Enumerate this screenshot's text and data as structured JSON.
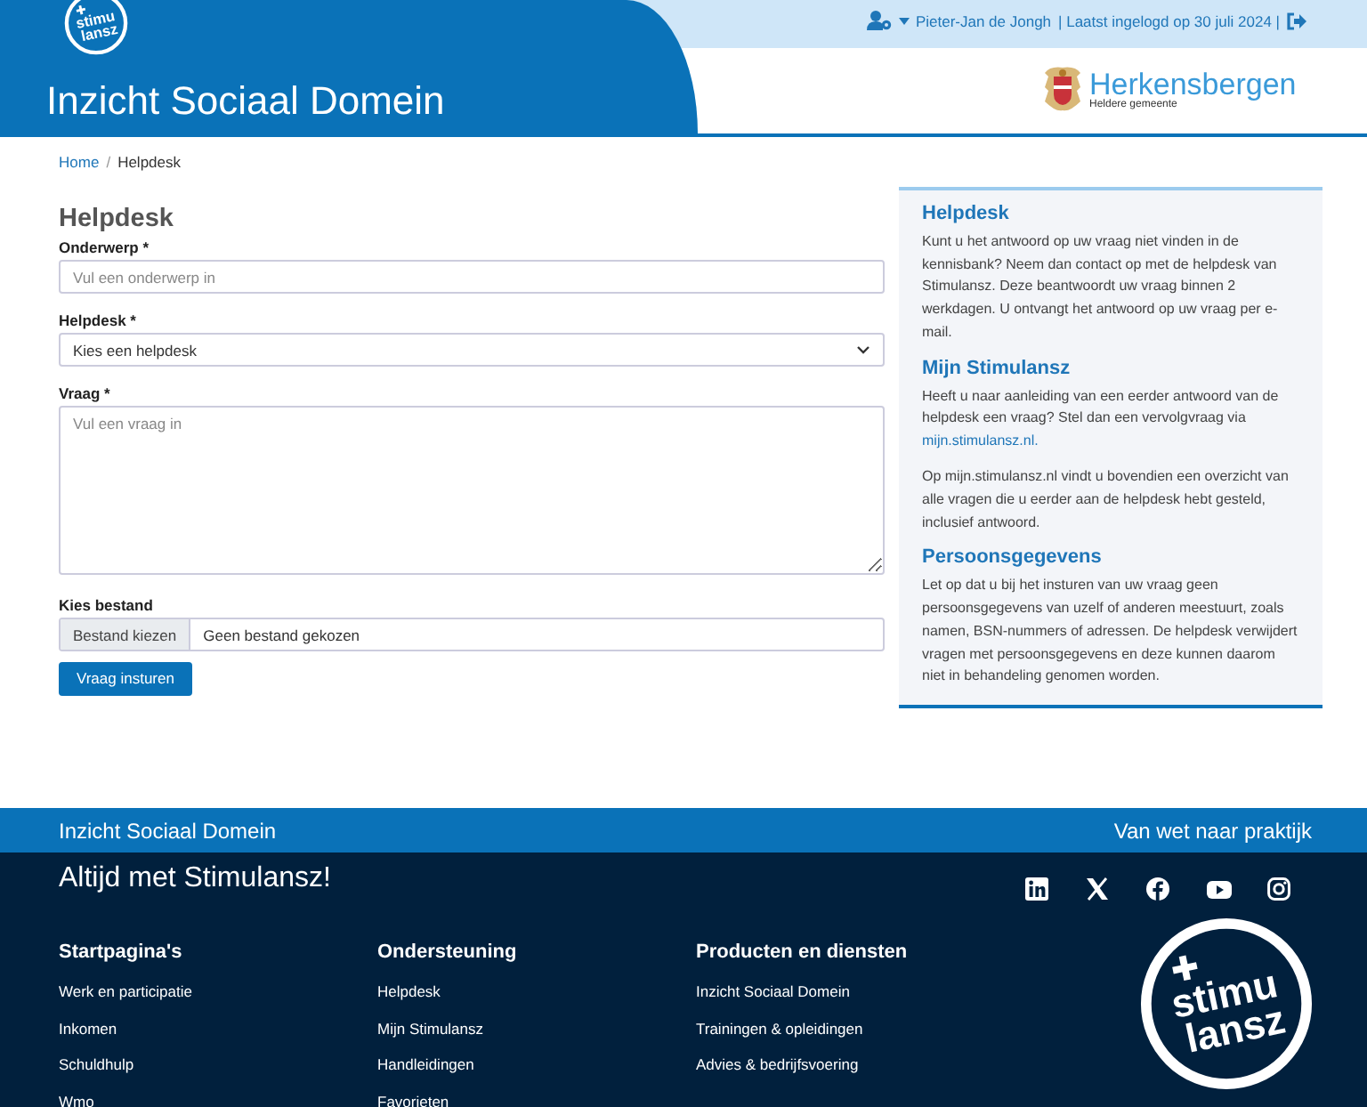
{
  "header": {
    "logo": {
      "top": "stimu",
      "bottom": "lansz"
    },
    "title": "Inzicht Sociaal Domein",
    "user_name": "Pieter-Jan de Jongh",
    "last_login": "| Laatst ingelogd op 30 juli 2024 |",
    "municipality": {
      "name": "Herkensbergen",
      "tagline": "Heldere gemeente"
    }
  },
  "breadcrumb": {
    "separator": "/",
    "items": [
      {
        "label": "Home",
        "current": false
      },
      {
        "label": "Helpdesk",
        "current": true
      }
    ]
  },
  "form": {
    "title": "Helpdesk",
    "fields": [
      {
        "kind": "text",
        "label": "Onderwerp *",
        "placeholder": "Vul een onderwerp in"
      },
      {
        "kind": "select",
        "label": "Helpdesk *",
        "value": "Kies een helpdesk"
      },
      {
        "kind": "textarea",
        "label": "Vraag *",
        "placeholder": "Vul een vraag in"
      },
      {
        "kind": "file",
        "label": "Kies bestand",
        "button": "Bestand kiezen",
        "value": "Geen bestand gekozen"
      }
    ],
    "submit": "Vraag insturen"
  },
  "aside": [
    {
      "title": "Helpdesk",
      "paragraphs": [
        {
          "text": "Kunt u het antwoord op uw vraag niet vinden in de kennisbank? Neem dan contact op met de helpdesk van Stimulansz. Deze beantwoordt uw vraag binnen 2 werkdagen. U ontvangt het antwoord op uw vraag per e-mail."
        }
      ]
    },
    {
      "title": "Mijn Stimulansz",
      "paragraphs": [
        {
          "text": "Heeft u naar aanleiding van een eerder antwoord van de helpdesk een vraag? Stel dan een vervolgvraag via",
          "link": "mijn.stimulansz.nl."
        },
        {
          "text": "Op mijn.stimulansz.nl vindt u bovendien een overzicht van alle vragen die u eerder aan de helpdesk hebt gesteld, inclusief antwoord."
        }
      ]
    },
    {
      "title": "Persoonsgegevens",
      "paragraphs": [
        {
          "text": "Let op dat u bij het insturen van uw vraag geen persoonsgegevens van uzelf of anderen meestuurt, zoals namen, BSN-nummers of adressen. De helpdesk verwijdert vragen met persoonsgegevens en deze kunnen daarom niet in behandeling genomen worden."
        }
      ]
    }
  ],
  "footer": {
    "bar_left": "Inzicht Sociaal Domein",
    "bar_right": "Van wet naar praktijk",
    "slogan": "Altijd met Stimulansz!",
    "social": [
      {
        "kind": "linkedin"
      },
      {
        "kind": "x"
      },
      {
        "kind": "facebook"
      },
      {
        "kind": "youtube"
      },
      {
        "kind": "instagram"
      }
    ],
    "columns": [
      {
        "title": "Startpagina's",
        "links": [
          "Werk en participatie",
          "Inkomen",
          "Schuldhulp",
          "Wmo"
        ]
      },
      {
        "title": "Ondersteuning",
        "links": [
          "Helpdesk",
          "Mijn Stimulansz",
          "Handleidingen",
          "Favorieten"
        ]
      },
      {
        "title": "Producten en diensten",
        "links": [
          "Inzicht Sociaal Domein",
          "Trainingen & opleidingen",
          "Advies & bedrijfsvoering"
        ]
      }
    ],
    "logo": {
      "top": "stimu",
      "bottom": "lansz"
    }
  }
}
